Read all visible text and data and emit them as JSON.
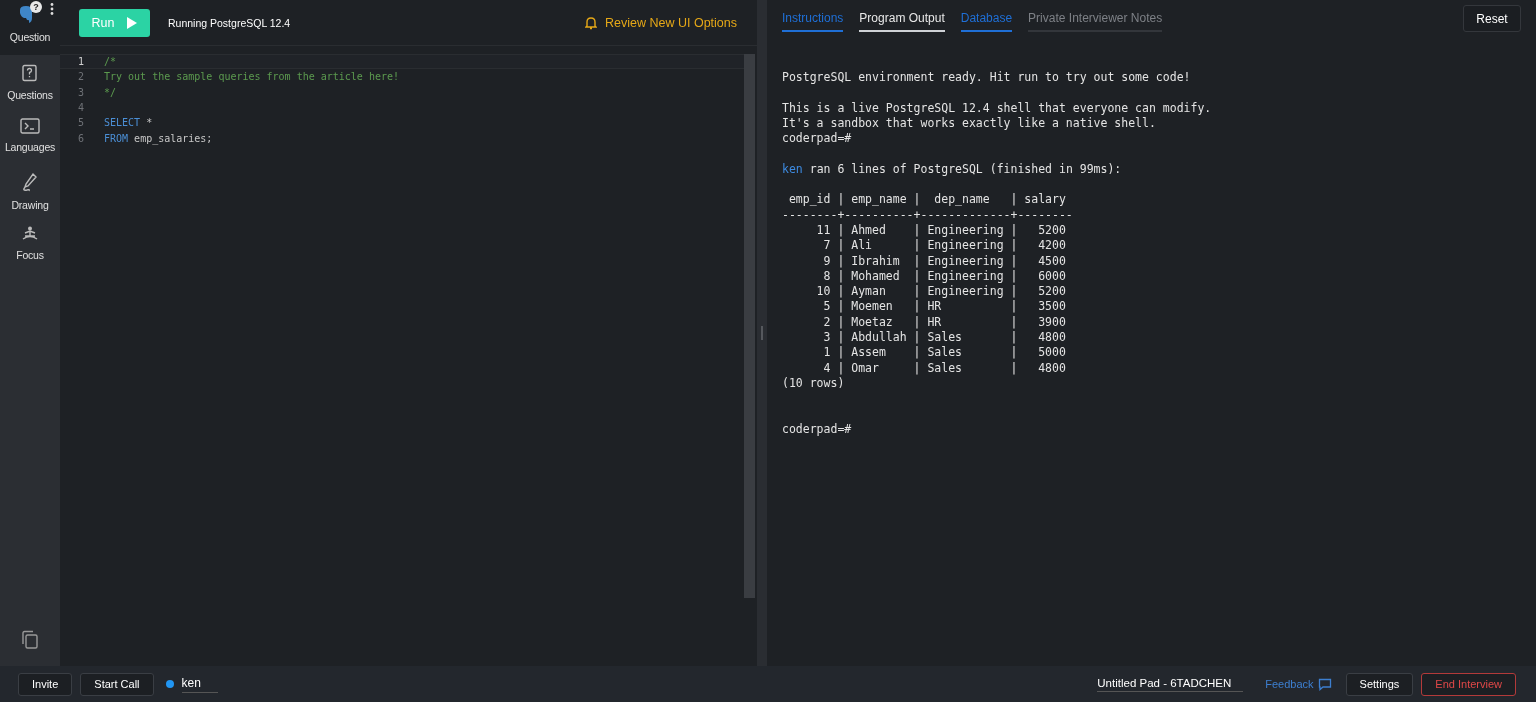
{
  "sidebar": {
    "header": {
      "label": "Question",
      "badge": "?"
    },
    "items": [
      {
        "label": "Questions"
      },
      {
        "label": "Languages"
      },
      {
        "label": "Drawing"
      },
      {
        "label": "Focus"
      }
    ]
  },
  "toolbar": {
    "run_button": "Run",
    "status": "Running PostgreSQL 12.4",
    "notice": "Review New UI Options"
  },
  "editor": {
    "lines": [
      {
        "number": "1",
        "current": true,
        "tokens": [
          {
            "kind": "comment",
            "text": "/*"
          }
        ]
      },
      {
        "number": "2",
        "current": false,
        "tokens": [
          {
            "kind": "comment",
            "text": "Try out the sample queries from the article here!"
          }
        ]
      },
      {
        "number": "3",
        "current": false,
        "tokens": [
          {
            "kind": "comment",
            "text": "*/"
          }
        ]
      },
      {
        "number": "4",
        "current": false
      },
      {
        "number": "5",
        "current": false,
        "tokens": [
          {
            "kind": "keyword",
            "text": "SELECT"
          },
          {
            "kind": "plain",
            "text": " *"
          }
        ]
      },
      {
        "number": "6",
        "current": false,
        "tokens": [
          {
            "kind": "keyword",
            "text": "FROM"
          },
          {
            "kind": "plain",
            "text": " emp_salaries;"
          }
        ]
      }
    ]
  },
  "tabs": [
    {
      "label": "Instructions",
      "selected": false,
      "color": "#1f6fd6"
    },
    {
      "label": "Program Output",
      "selected": true,
      "color": "#e8e8e8"
    },
    {
      "label": "Database",
      "selected": false,
      "color": "#1f6fd6"
    },
    {
      "label": "Private Interviewer Notes",
      "selected": false,
      "color": "#7d8086"
    }
  ],
  "reset_button": "Reset",
  "output": {
    "lines": [
      {
        "kind": "text",
        "text": "PostgreSQL environment ready. Hit run to try out some code!"
      },
      {
        "kind": "blank"
      },
      {
        "kind": "text",
        "text": "This is a live PostgreSQL 12.4 shell that everyone can modify."
      },
      {
        "kind": "text",
        "text": "It's a sandbox that works exactly like a native shell."
      },
      {
        "kind": "text",
        "text": "coderpad=#"
      },
      {
        "kind": "blank"
      },
      {
        "kind": "run",
        "user": "ken",
        "text": " ran 6 lines of PostgreSQL (finished in 99ms):"
      },
      {
        "kind": "blank"
      },
      {
        "kind": "text",
        "text": " emp_id | emp_name |  dep_name   | salary"
      },
      {
        "kind": "text",
        "text": "--------+----------+-------------+--------"
      },
      {
        "kind": "text",
        "text": "     11 | Ahmed    | Engineering |   5200"
      },
      {
        "kind": "text",
        "text": "      7 | Ali      | Engineering |   4200"
      },
      {
        "kind": "text",
        "text": "      9 | Ibrahim  | Engineering |   4500"
      },
      {
        "kind": "text",
        "text": "      8 | Mohamed  | Engineering |   6000"
      },
      {
        "kind": "text",
        "text": "     10 | Ayman    | Engineering |   5200"
      },
      {
        "kind": "text",
        "text": "      5 | Moemen   | HR          |   3500"
      },
      {
        "kind": "text",
        "text": "      2 | Moetaz   | HR          |   3900"
      },
      {
        "kind": "text",
        "text": "      3 | Abdullah | Sales       |   4800"
      },
      {
        "kind": "text",
        "text": "      1 | Assem    | Sales       |   5000"
      },
      {
        "kind": "text",
        "text": "      4 | Omar     | Sales       |   4800"
      },
      {
        "kind": "text",
        "text": "(10 rows)"
      },
      {
        "kind": "blank"
      },
      {
        "kind": "blank"
      },
      {
        "kind": "text",
        "text": "coderpad=#"
      }
    ]
  },
  "footer": {
    "invite_button": "Invite",
    "call_button": "Start Call",
    "user": {
      "name": "ken",
      "color": "#2196f3"
    },
    "pad_title": "Untitled Pad - 6TADCHEN",
    "feedback_link": "Feedback",
    "settings_button": "Settings",
    "end_button": "End Interview"
  }
}
